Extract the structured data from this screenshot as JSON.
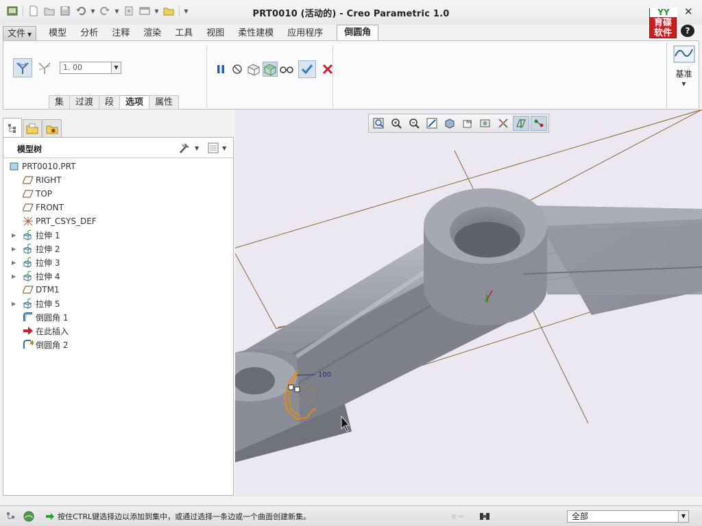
{
  "window": {
    "title": "PRT0010 (活动的) - Creo Parametric 1.0",
    "logo_text_top": "YY",
    "logo_text": "育碟\n软件",
    "close_icon": "close-icon",
    "help_icon": "help-icon"
  },
  "quick_access": [
    "new-icon",
    "open-icon",
    "save-icon",
    "undo-icon",
    "redo-icon",
    "regenerate-icon",
    "windows-icon",
    "folder-icon"
  ],
  "ribbon_tabs": {
    "file": "文件",
    "items": [
      "模型",
      "分析",
      "注释",
      "渲染",
      "工具",
      "视图",
      "柔性建模",
      "应用程序"
    ],
    "active": "倒圆角"
  },
  "ribbon": {
    "radius_value": "1. 00",
    "subtabs": [
      "集",
      "过渡",
      "段",
      "选项",
      "属性"
    ],
    "active_subtab": "选项",
    "datum_label": "基准"
  },
  "model_tree": {
    "title": "模型树",
    "items": [
      {
        "label": "PRT0010.PRT",
        "icon": "part-icon",
        "expandable": false
      },
      {
        "label": "RIGHT",
        "icon": "datum-plane-icon",
        "expandable": false
      },
      {
        "label": "TOP",
        "icon": "datum-plane-icon",
        "expandable": false
      },
      {
        "label": "FRONT",
        "icon": "datum-plane-icon",
        "expandable": false
      },
      {
        "label": "PRT_CSYS_DEF",
        "icon": "coordinate-system-icon",
        "expandable": false
      },
      {
        "label": "拉伸 1",
        "icon": "extrude-icon",
        "expandable": true
      },
      {
        "label": "拉伸 2",
        "icon": "extrude-icon",
        "expandable": true
      },
      {
        "label": "拉伸 3",
        "icon": "extrude-icon",
        "expandable": true
      },
      {
        "label": "拉伸 4",
        "icon": "extrude-icon",
        "expandable": true
      },
      {
        "label": "DTM1",
        "icon": "datum-plane-icon",
        "expandable": false
      },
      {
        "label": "拉伸 5",
        "icon": "extrude-icon",
        "expandable": true
      },
      {
        "label": "倒圆角 1",
        "icon": "round-icon",
        "expandable": false
      },
      {
        "label": "在此插入",
        "icon": "insert-here-icon",
        "expandable": false
      },
      {
        "label": "倒圆角 2",
        "icon": "round-active-icon",
        "expandable": false
      }
    ]
  },
  "viewport": {
    "dimension_label": "100",
    "background": "#ebe8f1",
    "model_color": "#9ea2ad",
    "edge_highlight": "#e08a12",
    "datum_color": "#8a6430"
  },
  "status": {
    "message": "按住CTRL键选择边以添加到集中，或通过选择一条边或一个曲面创建新集。",
    "filter_value": "全部"
  },
  "colors": {
    "accent": "#2a5ea8",
    "cancel": "#c8202a",
    "ok": "#3b78c4"
  }
}
